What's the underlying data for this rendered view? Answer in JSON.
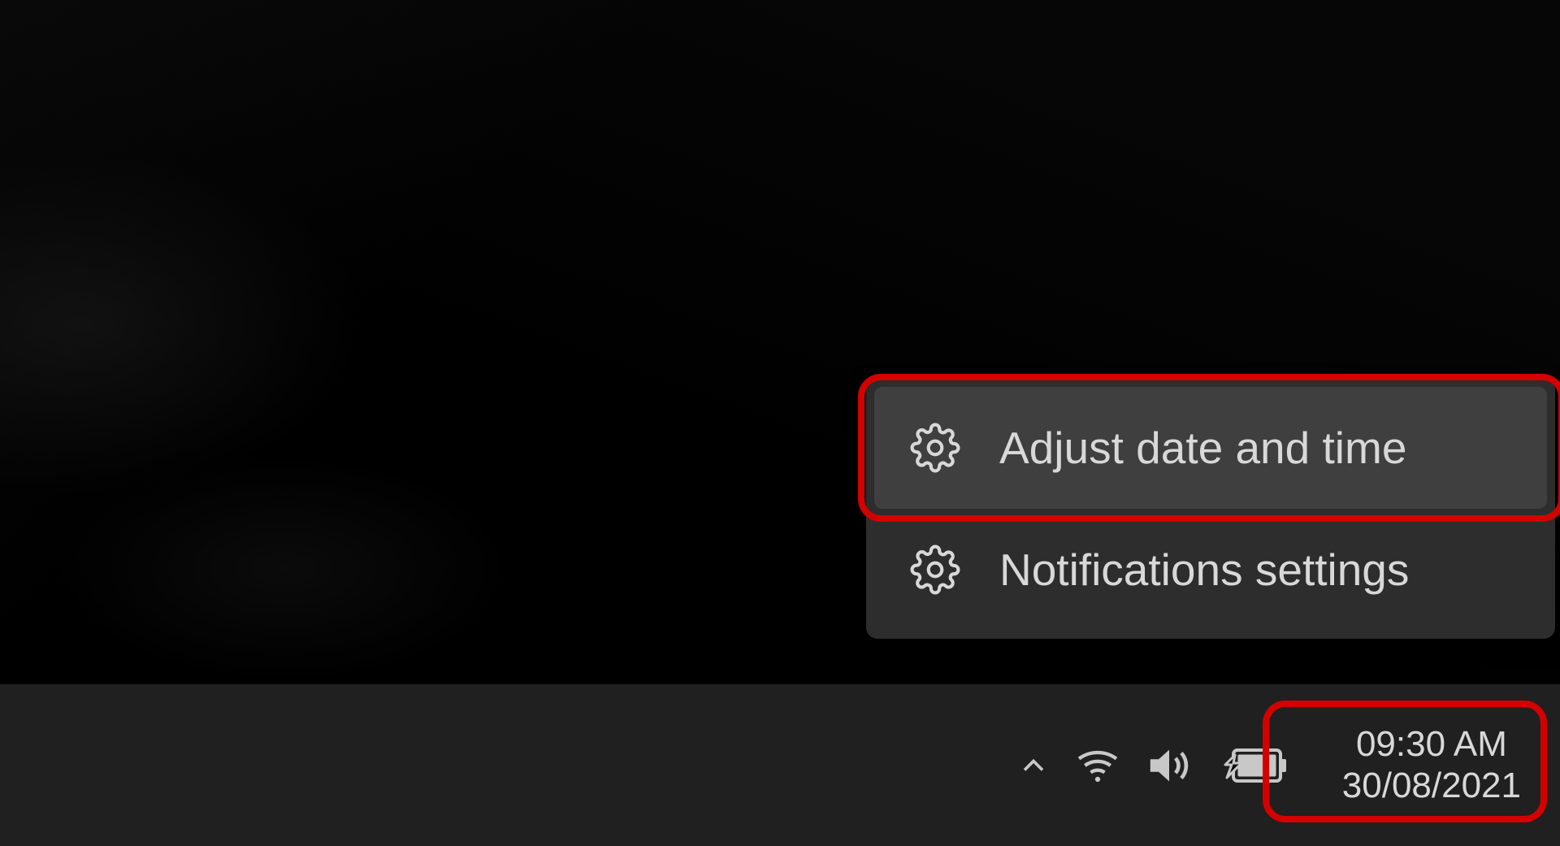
{
  "context_menu": {
    "items": [
      {
        "label": "Adjust date and time",
        "icon": "gear-icon",
        "hover": true
      },
      {
        "label": "Notifications settings",
        "icon": "gear-icon",
        "hover": false
      }
    ]
  },
  "taskbar": {
    "clock": {
      "time": "09:30 AM",
      "date": "30/08/2021"
    },
    "tray_icons": [
      "chevron-up-icon",
      "wifi-icon",
      "speaker-icon",
      "battery-charging-icon"
    ]
  },
  "highlights": {
    "menu_item_index": 0,
    "clock": true,
    "color": "#d40000"
  }
}
